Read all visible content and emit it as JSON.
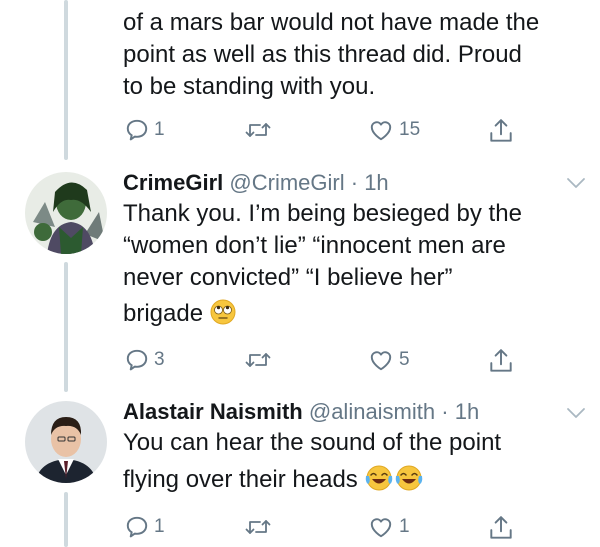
{
  "top_tweet": {
    "lines": [
      "of a mars bar would not have made the",
      "point as well as this thread did. Proud",
      "to be standing with you."
    ],
    "replies": "1",
    "likes": "15"
  },
  "tweet1": {
    "name": "CrimeGirl",
    "handle": "@CrimeGirl",
    "dot": "·",
    "time": "1h",
    "lines": [
      "Thank you. I’m being besieged by the",
      "“women don’t lie” “innocent men are",
      "never convicted” “I believe her”",
      "brigade"
    ],
    "emoji": "eye-roll-emoji",
    "replies": "3",
    "likes": "5"
  },
  "tweet2": {
    "name": "Alastair Naismith",
    "handle": "@alinaismith",
    "dot": "·",
    "time": "1h",
    "lines": [
      "You can hear the sound of the point",
      "flying over their heads"
    ],
    "emoji": "tears-of-joy-emoji",
    "replies": "1",
    "likes": "1"
  },
  "icons": [
    "reply-icon",
    "retweet-icon",
    "like-icon",
    "share-icon",
    "chevron-down-icon"
  ],
  "colors": {
    "text": "#14171a",
    "muted": "#657786",
    "thread_line": "#cfd9de",
    "background": "#ffffff"
  }
}
